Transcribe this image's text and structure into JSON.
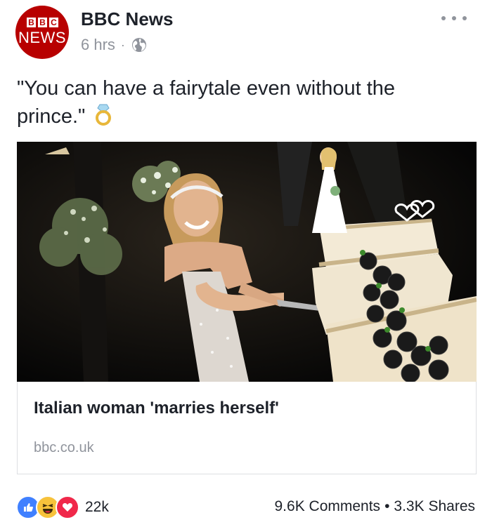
{
  "post": {
    "page_name": "BBC News",
    "avatar": {
      "top": "BBC",
      "letters": [
        "B",
        "B",
        "C"
      ],
      "bottom": "NEWS"
    },
    "time": "6 hrs",
    "separator": "·",
    "privacy_icon": "globe-icon",
    "more_icon": "more-options-icon",
    "text_line1": "\"You can have a fairytale even without the",
    "text_line2": "prince.\"",
    "emoji_icon": "ring-icon"
  },
  "link_card": {
    "image_icon": "wedding-photo",
    "title": "Italian woman 'marries herself'",
    "domain": "bbc.co.uk"
  },
  "footer": {
    "reaction_icons": [
      "like-icon",
      "haha-icon",
      "love-icon"
    ],
    "reaction_count": "22k",
    "comments": "9.6K Comments",
    "dot": "•",
    "shares": "3.3K Shares"
  },
  "colors": {
    "bbc_red": "#b80000",
    "like_blue": "#4080ff",
    "haha_yellow": "#f7c23b",
    "love_red": "#f0284a",
    "meta_gray": "#90949c"
  }
}
